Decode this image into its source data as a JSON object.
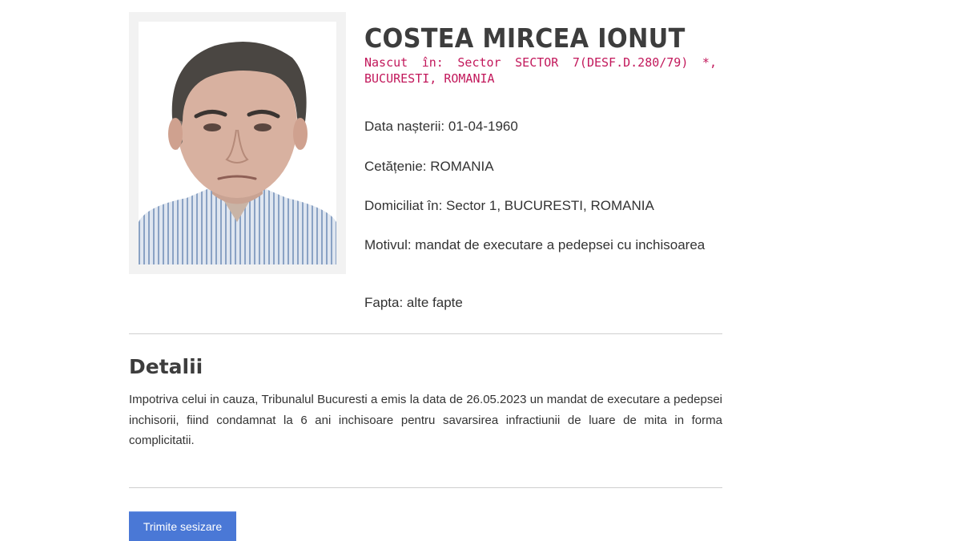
{
  "person": {
    "name": "COSTEA MIRCEA IONUT",
    "born_in": "Nascut în: Sector SECTOR 7(DESF.D.280/79) *, BUCURESTI, ROMANIA",
    "photo_alt": "portrait-photo"
  },
  "fields": {
    "birth_date": "Data nașterii: 01-04-1960",
    "citizenship": "Cetățenie: ROMANIA",
    "domicile": "Domiciliat în: Sector 1, BUCURESTI, ROMANIA",
    "reason": "Motivul: mandat de executare a pedepsei cu inchisoarea",
    "offense": "Fapta: alte fapte"
  },
  "details": {
    "title": "Detalii",
    "text": "Impotriva celui in cauza, Tribunalul Bucuresti a emis la data de 26.05.2023 un mandat de executare a pedepsei inchisorii, fiind condamnat la 6 ani inchisoare pentru savarsirea infractiunii de luare de mita in forma complicitatii."
  },
  "actions": {
    "submit_label": "Trimite sesizare"
  },
  "colors": {
    "name": "#3d3d3d",
    "born_in": "#c2185b",
    "button": "#4a78d6",
    "divider": "#cfcfcf"
  }
}
